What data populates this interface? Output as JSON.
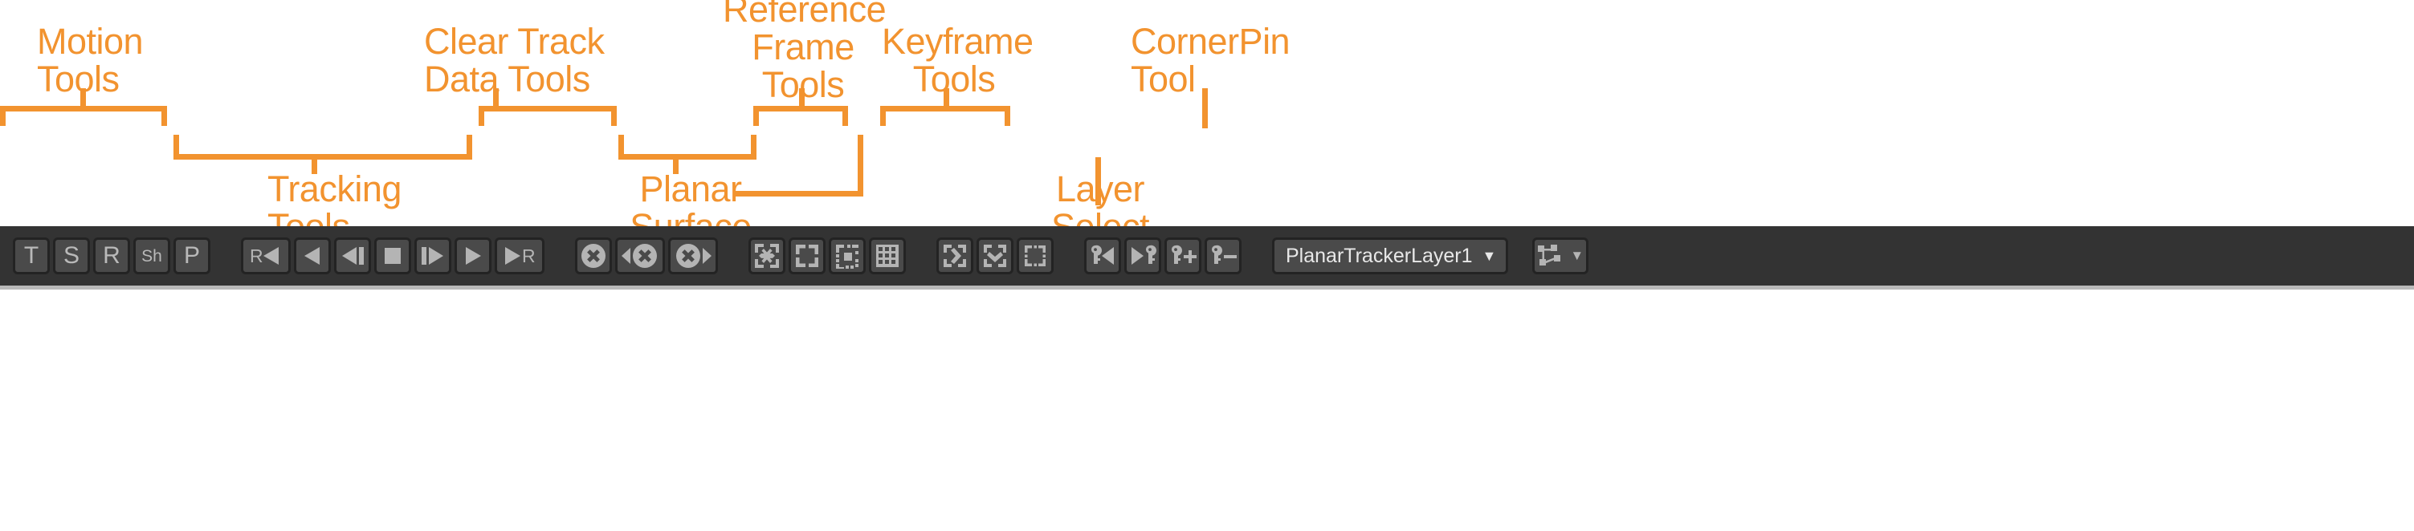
{
  "accent_color": "#F2932F",
  "toolbar": {
    "background": "#333333",
    "button_face": "#4a4a4a",
    "button_border": "#232323",
    "glyph_color": "#b4b4b4",
    "motion_tools": [
      {
        "name": "translation",
        "label": "T",
        "size": "big"
      },
      {
        "name": "scale",
        "label": "S",
        "size": "big"
      },
      {
        "name": "rotation",
        "label": "R",
        "size": "big"
      },
      {
        "name": "shear",
        "label": "Sh",
        "size": "small"
      },
      {
        "name": "perspective",
        "label": "P",
        "size": "big"
      }
    ],
    "tracking_tools": [
      {
        "name": "track-backwards-from-reference",
        "icon": "r-rewind"
      },
      {
        "name": "track-backwards",
        "icon": "play-back"
      },
      {
        "name": "track-backwards-one-frame",
        "icon": "step-back"
      },
      {
        "name": "stop-tracking",
        "icon": "stop"
      },
      {
        "name": "track-forwards-one-frame",
        "icon": "step-forward"
      },
      {
        "name": "track-forwards",
        "icon": "play-forward"
      },
      {
        "name": "track-forwards-to-reference",
        "icon": "fast-forward-r"
      }
    ],
    "clear_track_data_tools": [
      {
        "name": "clear-all-track-data",
        "icon": "clear-x"
      },
      {
        "name": "clear-track-data-backwards",
        "icon": "clear-x-back"
      },
      {
        "name": "clear-track-data-forwards",
        "icon": "clear-x-forward"
      }
    ],
    "planar_surface_tools": [
      {
        "name": "show-planar-surface",
        "icon": "surface-move"
      },
      {
        "name": "hide-planar-surface",
        "icon": "surface-corners"
      },
      {
        "name": "planar-surface-mask",
        "icon": "surface-mask"
      },
      {
        "name": "show-grid",
        "icon": "grid"
      }
    ],
    "reference_frame_tools": [
      {
        "name": "set-reference-frame-forward",
        "icon": "ref-forward"
      },
      {
        "name": "set-reference-frame",
        "icon": "ref-down"
      },
      {
        "name": "show-reference-frame-mask",
        "icon": "ref-mask"
      }
    ],
    "keyframe_tools": [
      {
        "name": "previous-keyframe",
        "icon": "key-prev"
      },
      {
        "name": "next-keyframe",
        "icon": "key-next"
      },
      {
        "name": "add-keyframe",
        "icon": "key-add"
      },
      {
        "name": "delete-keyframe",
        "icon": "key-remove"
      }
    ],
    "layer_select": {
      "name": "layer-select",
      "value": "PlanarTrackerLayer1",
      "caret": "▼"
    },
    "cornerpin": {
      "name": "cornerpin-tool",
      "icon": "cornerpin",
      "caret": "▼"
    }
  },
  "annotations": {
    "motion_tools": "Motion\nTools",
    "tracking_tools": "Tracking\nTools",
    "clear_track_data_tools": "Clear Track\nData Tools",
    "planar_surface_tools": "Planar\nSurface\nTools",
    "reference_frame_tools": "Reference\nFrame\nTools",
    "keyframe_tools": "Keyframe\nTools",
    "layer_select_tool": "Layer\nSelect\nTool",
    "cornerpin_tool": "CornerPin\nTool"
  }
}
